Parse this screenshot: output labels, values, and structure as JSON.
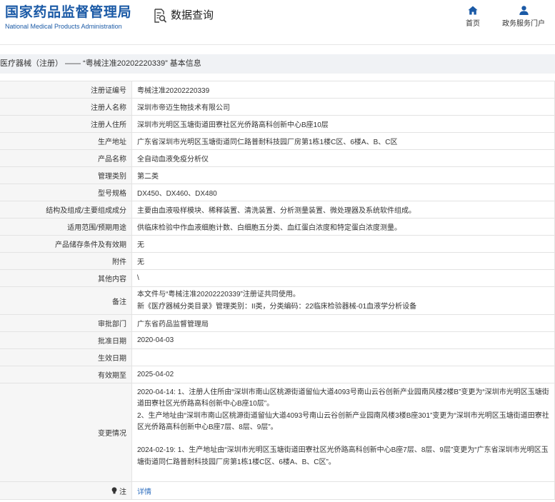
{
  "header": {
    "logo": {
      "title": "国家药品监督管理局",
      "subtitle": "National Medical Products Administration"
    },
    "query": {
      "label": "数据查询",
      "icon": "document-search-icon"
    },
    "nav": [
      {
        "label": "首页",
        "icon": "home-icon"
      },
      {
        "label": "政务服务门户",
        "icon": "user-icon"
      }
    ]
  },
  "title_bar": {
    "text": "医疗器械（注册） —— “粤械注准20202220339” 基本信息"
  },
  "record": {
    "fields": [
      {
        "label": "注册证编号",
        "value": "粤械注准20202220339"
      },
      {
        "label": "注册人名称",
        "value": "深圳市帝迈生物技术有限公司"
      },
      {
        "label": "注册人住所",
        "value": "深圳市光明区玉塘街道田寮社区光侨路高科创新中心B座10层"
      },
      {
        "label": "生产地址",
        "value": "广东省深圳市光明区玉塘街道同仁路普耐科技园厂房第1栋1楼C区、6楼A、B、C区"
      },
      {
        "label": "产品名称",
        "value": "全自动血液免疫分析仪"
      },
      {
        "label": "管理类别",
        "value": "第二类"
      },
      {
        "label": "型号规格",
        "value": "DX450、DX460、DX480"
      },
      {
        "label": "结构及组成/主要组成成分",
        "value": "主要由血液吸样模块、稀释装置、清洗装置、分析测量装置、微处理器及系统软件组成。"
      },
      {
        "label": "适用范围/预期用途",
        "value": "供临床检验中作血液细胞计数、白细胞五分类、血红蛋白浓度和特定蛋白浓度测量。"
      },
      {
        "label": "产品储存条件及有效期",
        "value": "无"
      },
      {
        "label": "附件",
        "value": "无"
      },
      {
        "label": "其他内容",
        "value": "\\"
      },
      {
        "label": "备注",
        "lines": [
          "本文件与“粤械注准20202220339”注册证共同使用。",
          "新《医疗器械分类目录》管理类别：II类，分类编码：22临床检验器械-01血液学分析设备"
        ]
      },
      {
        "label": "审批部门",
        "value": "广东省药品监督管理局"
      },
      {
        "label": "批准日期",
        "value": "2020-04-03"
      },
      {
        "label": "生效日期",
        "value": ""
      },
      {
        "label": "有效期至",
        "value": "2025-04-02"
      },
      {
        "label": "变更情况",
        "changes": [
          [
            "2020-04-14: 1、注册人住所由“深圳市南山区桃源街道留仙大道4093号南山云谷创新产业园南风楼2楼B”变更为“深圳市光明区玉塘街道田寮社区光侨路高科创新中心B座10层”。",
            "2、生产地址由“深圳市南山区桃源街道留仙大道4093号南山云谷创新产业园南风楼3楼B座301”变更为“深圳市光明区玉塘街道田寮社区光侨路高科创新中心B座7层、8层、9层”。"
          ],
          [
            "2024-02-19: 1、生产地址由“深圳市光明区玉塘街道田寮社区光侨路高科创新中心B座7层、8层、9层”变更为“广东省深圳市光明区玉塘街道同仁路普耐科技园厂房第1栋1楼C区、6楼A、B、C区”。"
          ]
        ]
      },
      {
        "label": "注",
        "icon": "lightbulb-icon",
        "link": "详情"
      }
    ]
  },
  "colors": {
    "brand": "#1b5aa6",
    "link": "#2f6fbf",
    "text": "#333333",
    "label_bg": "#f6f6f6",
    "border": "#e3e3e3",
    "bar_bg": "#f0f2f5"
  }
}
